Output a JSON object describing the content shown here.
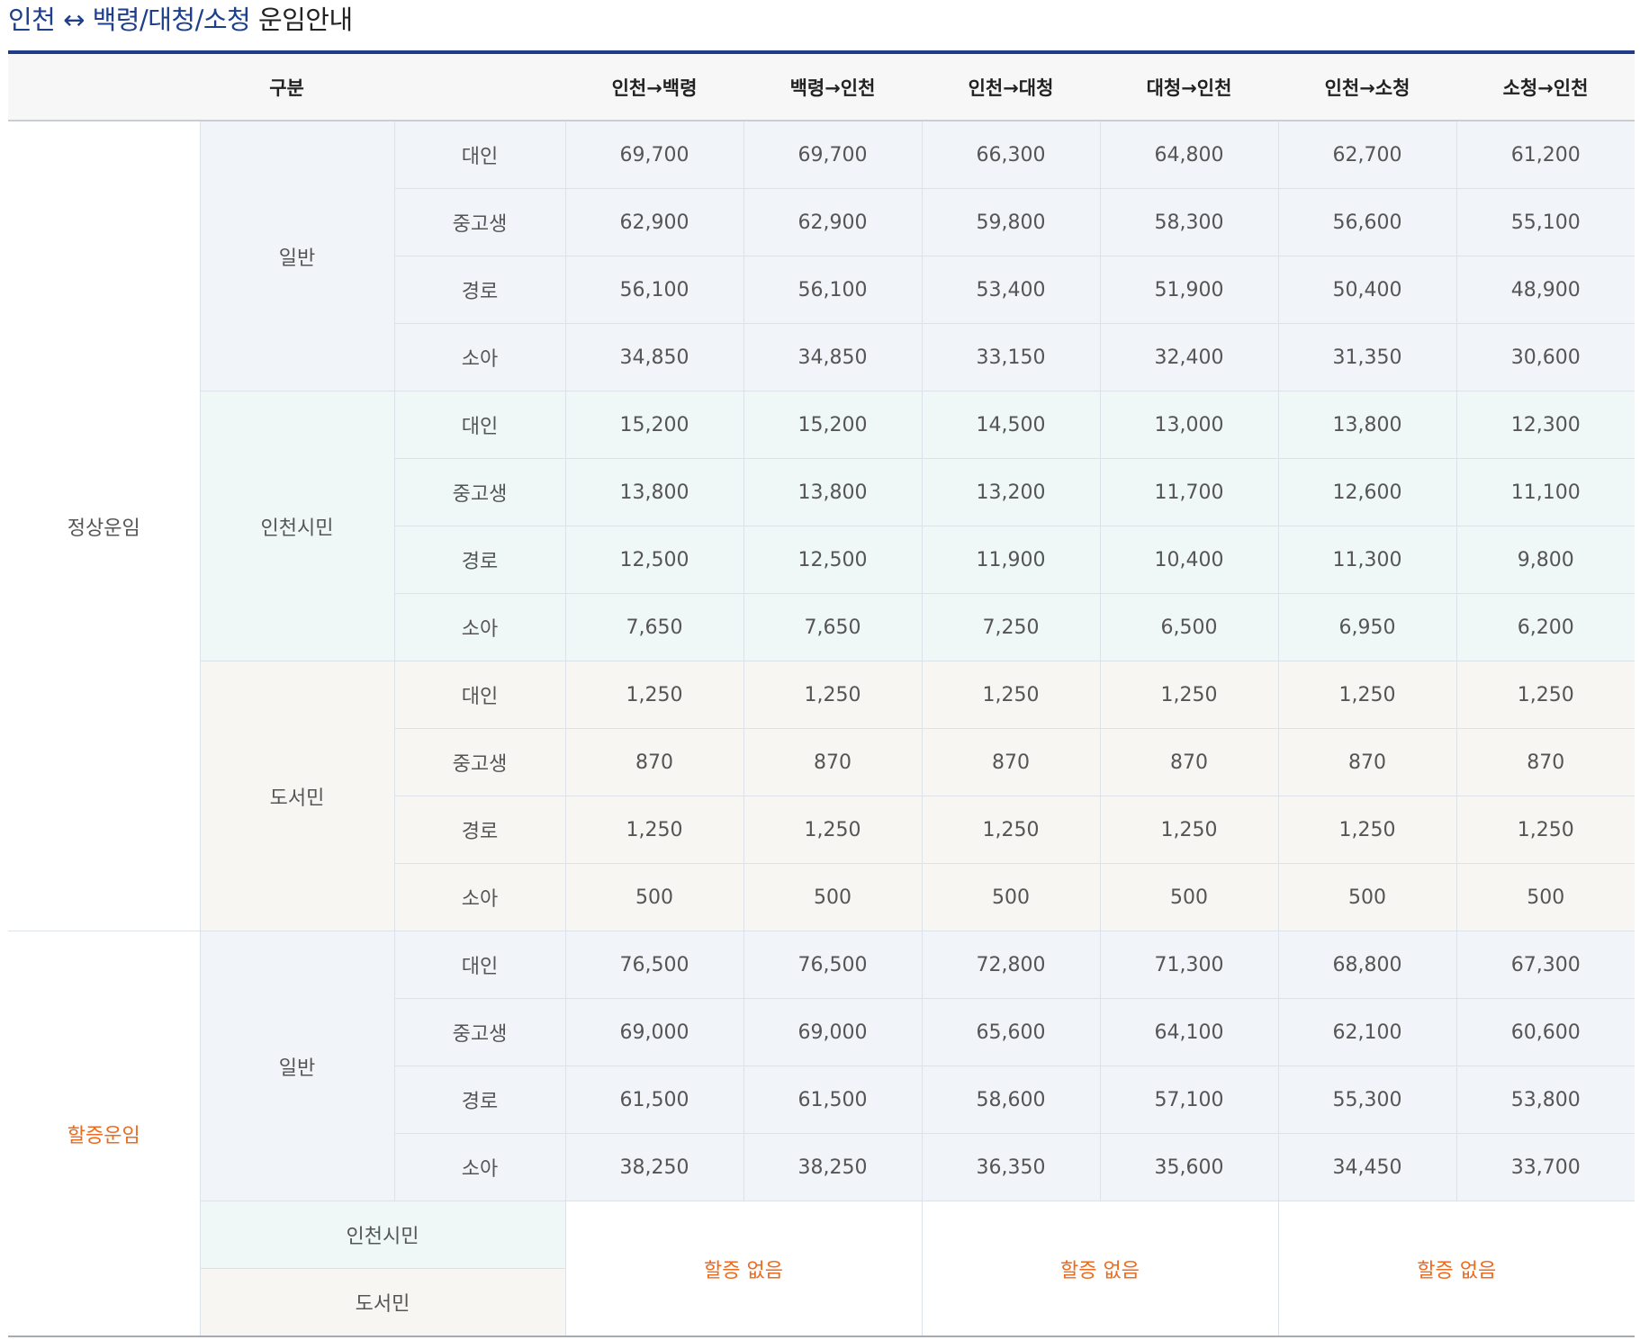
{
  "title": {
    "main": "인천 ↔ 백령/대청/소청",
    "suffix": "운임안내"
  },
  "header": {
    "category": "구분",
    "routes": [
      "인천→백령",
      "백령→인천",
      "인천→대청",
      "대청→인천",
      "인천→소청",
      "소청→인천"
    ]
  },
  "regular": {
    "label": "정상운임",
    "groups": [
      {
        "name": "일반",
        "rows": [
          {
            "type": "대인",
            "fares": [
              "69,700",
              "69,700",
              "66,300",
              "64,800",
              "62,700",
              "61,200"
            ]
          },
          {
            "type": "중고생",
            "fares": [
              "62,900",
              "62,900",
              "59,800",
              "58,300",
              "56,600",
              "55,100"
            ]
          },
          {
            "type": "경로",
            "fares": [
              "56,100",
              "56,100",
              "53,400",
              "51,900",
              "50,400",
              "48,900"
            ]
          },
          {
            "type": "소아",
            "fares": [
              "34,850",
              "34,850",
              "33,150",
              "32,400",
              "31,350",
              "30,600"
            ]
          }
        ]
      },
      {
        "name": "인천시민",
        "rows": [
          {
            "type": "대인",
            "fares": [
              "15,200",
              "15,200",
              "14,500",
              "13,000",
              "13,800",
              "12,300"
            ]
          },
          {
            "type": "중고생",
            "fares": [
              "13,800",
              "13,800",
              "13,200",
              "11,700",
              "12,600",
              "11,100"
            ]
          },
          {
            "type": "경로",
            "fares": [
              "12,500",
              "12,500",
              "11,900",
              "10,400",
              "11,300",
              "9,800"
            ]
          },
          {
            "type": "소아",
            "fares": [
              "7,650",
              "7,650",
              "7,250",
              "6,500",
              "6,950",
              "6,200"
            ]
          }
        ]
      },
      {
        "name": "도서민",
        "rows": [
          {
            "type": "대인",
            "fares": [
              "1,250",
              "1,250",
              "1,250",
              "1,250",
              "1,250",
              "1,250"
            ]
          },
          {
            "type": "중고생",
            "fares": [
              "870",
              "870",
              "870",
              "870",
              "870",
              "870"
            ]
          },
          {
            "type": "경로",
            "fares": [
              "1,250",
              "1,250",
              "1,250",
              "1,250",
              "1,250",
              "1,250"
            ]
          },
          {
            "type": "소아",
            "fares": [
              "500",
              "500",
              "500",
              "500",
              "500",
              "500"
            ]
          }
        ]
      }
    ]
  },
  "surcharge": {
    "label": "할증운임",
    "general": {
      "name": "일반",
      "rows": [
        {
          "type": "대인",
          "fares": [
            "76,500",
            "76,500",
            "72,800",
            "71,300",
            "68,800",
            "67,300"
          ]
        },
        {
          "type": "중고생",
          "fares": [
            "69,000",
            "69,000",
            "65,600",
            "64,100",
            "62,100",
            "60,600"
          ]
        },
        {
          "type": "경로",
          "fares": [
            "61,500",
            "61,500",
            "58,600",
            "57,100",
            "55,300",
            "53,800"
          ]
        },
        {
          "type": "소아",
          "fares": [
            "38,250",
            "38,250",
            "36,350",
            "35,600",
            "34,450",
            "33,700"
          ]
        }
      ]
    },
    "citizen_name": "인천시민",
    "islander_name": "도서민",
    "no_surcharge": [
      "할증 없음",
      "할증 없음",
      "할증 없음"
    ]
  },
  "colors": {
    "title_blue": "#1d3f8c",
    "rule": "#1f3c88",
    "surcharge_orange": "#ee6a1c",
    "general_bg": "#f1f4f9",
    "citizen_bg": "#f0f8f7",
    "islander_bg": "#f8f6f2"
  }
}
